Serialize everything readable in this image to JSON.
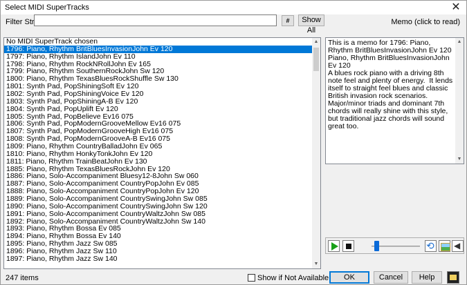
{
  "window": {
    "title": "Select MIDI SuperTracks",
    "close_glyph": "✕"
  },
  "filter": {
    "label": "Filter String",
    "value": "",
    "hash_label": "#",
    "show_all_label": "Show All"
  },
  "memo": {
    "header": "Memo (click to read)",
    "text": "This is a memo for 1796: Piano, Rhythm BritBluesInvasionJohn Ev 120\nPiano, Rhythm BritBluesInvasionJohn Ev 120\nA blues rock piano with a driving 8th note feel and plenty of energy.  It lends itself to straight feel blues and classic British invasion rock scenarios.  Major/minor triads and dominant 7th chords will really shine with this style, but traditional jazz chords will sound great too."
  },
  "list": {
    "selected_index": 1,
    "items": [
      "No MIDI SuperTrack chosen",
      "1796: Piano, Rhythm BritBluesInvasionJohn Ev 120",
      "1797: Piano, Rhythm IslandJohn Ev 110",
      "1798: Piano, Rhythm RockNRollJohn Ev 165",
      "1799: Piano, Rhythm SouthernRockJohn Sw 120",
      "1800: Piano, Rhythm TexasBluesRockShuffle Sw 130",
      "1801: Synth Pad, PopShiningSoft Ev 120",
      "1802: Synth Pad, PopShiningVoice Ev 120",
      "1803: Synth Pad, PopShiningA-B Ev 120",
      "1804: Synth Pad, PopUplift Ev 120",
      "1805: Synth Pad, PopBelieve Ev16 075",
      "1806: Synth Pad, PopModernGrooveMellow Ev16 075",
      "1807: Synth Pad, PopModernGrooveHigh Ev16 075",
      "1808: Synth Pad, PopModernGrooveA-B Ev16 075",
      "1809: Piano, Rhythm CountryBalladJohn Ev 065",
      "1810: Piano, Rhythm HonkyTonkJohn Ev 120",
      "1811: Piano, Rhythm TrainBeatJohn Ev 130",
      "1885: Piano, Rhythm TexasBluesRockJohn Ev 120",
      "1886: Piano, Solo-Accompaniment Bluesy12-8John Sw 060",
      "1887: Piano, Solo-Accompaniment CountryPopJohn Ev 085",
      "1888: Piano, Solo-Accompaniment CountryPopJohn Ev 120",
      "1889: Piano, Solo-Accompaniment CountrySwingJohn Sw 085",
      "1890: Piano, Solo-Accompaniment CountrySwingJohn Sw 120",
      "1891: Piano, Solo-Accompaniment CountryWaltzJohn Sw 085",
      "1892: Piano, Solo-Accompaniment CountryWaltzJohn Sw 140",
      "1893: Piano, Rhythm Bossa Ev 085",
      "1894: Piano, Rhythm Bossa Ev 140",
      "1895: Piano, Rhythm Jazz Sw 085",
      "1896: Piano, Rhythm Jazz Sw 110",
      "1897: Piano, Rhythm Jazz Sw 140"
    ]
  },
  "player": {
    "position": 0.05
  },
  "footer": {
    "item_count": "247 items",
    "checkbox_label": "Show if Not Available (N/A)",
    "checkbox_checked": false,
    "ok_label": "OK",
    "cancel_label": "Cancel",
    "help_label": "Help"
  },
  "colors": {
    "selection": "#0078d7",
    "play": "#18a018",
    "slider": "#0a6ad8"
  },
  "icons": [
    "close-icon",
    "play-icon",
    "stop-icon",
    "loop-icon",
    "picture-icon",
    "speaker-icon",
    "film-icon",
    "scroll-up-icon",
    "scroll-down-icon"
  ]
}
